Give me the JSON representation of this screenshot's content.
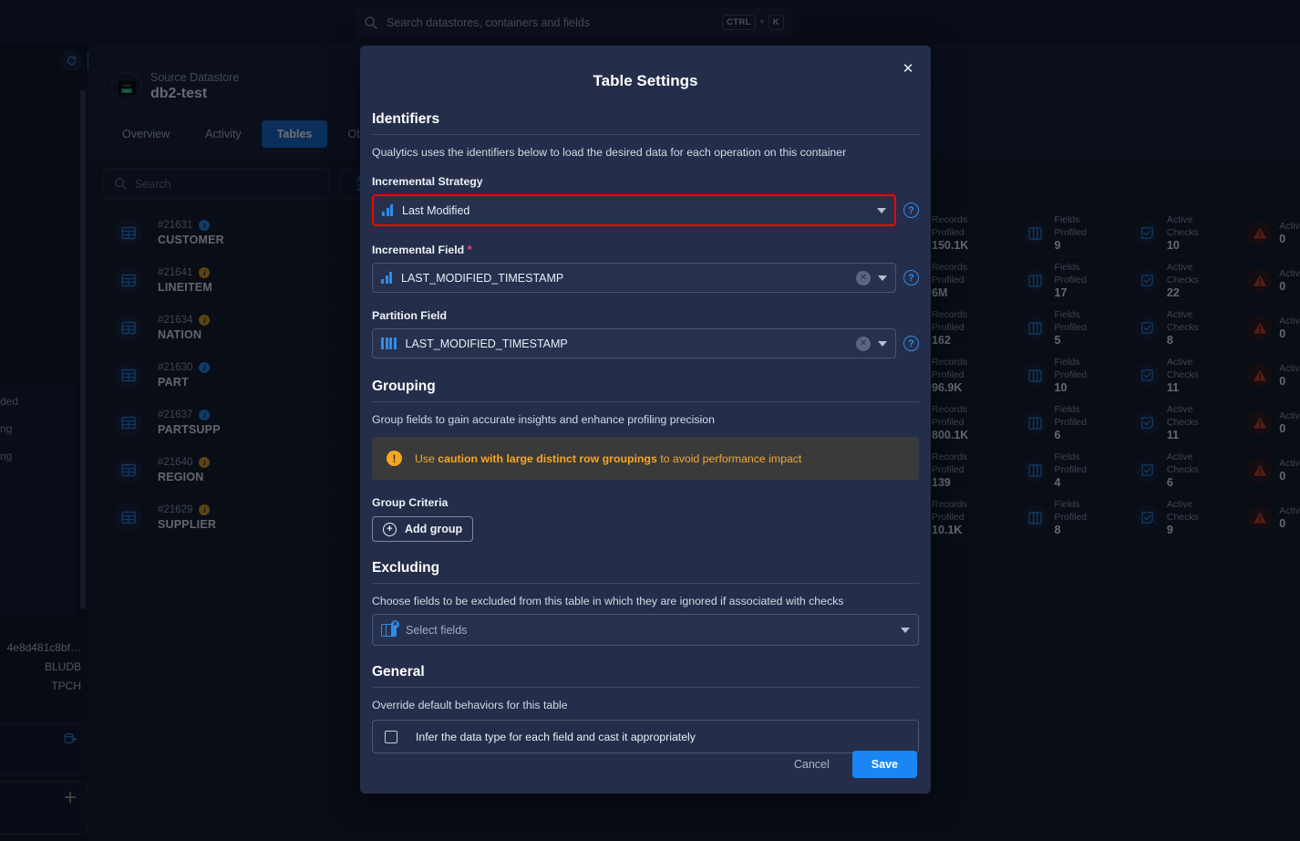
{
  "topbar": {
    "search_placeholder": "Search datastores, containers and fields",
    "shortcut_key1": "CTRL",
    "shortcut_plus": "+",
    "shortcut_key2": "K"
  },
  "datastore": {
    "kicker": "Source Datastore",
    "name": "db2-test",
    "logo_top": "IBM",
    "logo_bottom": "DB2",
    "tabs": [
      {
        "label": "Overview",
        "active": false
      },
      {
        "label": "Activity",
        "active": false
      },
      {
        "label": "Tables",
        "active": true
      },
      {
        "label": "Observ",
        "active": false
      }
    ],
    "toolbar": {
      "search_placeholder": "Search",
      "sort_a": "A",
      "sort_z": "Z"
    },
    "fragments": [
      "ded",
      "ng",
      "ng"
    ],
    "meta": [
      "4e8d481c8bf…",
      "BLUDB",
      "TPCH"
    ]
  },
  "tables": [
    {
      "id": "#21631",
      "name": "CUSTOMER",
      "badge": "blue",
      "stats": [
        {
          "label": "Records Profiled",
          "value": "150.1K",
          "icon": "none"
        },
        {
          "label": "Fields Profiled",
          "value": "9",
          "icon": "columns-icon"
        },
        {
          "label": "Active Checks",
          "value": "10",
          "icon": "check-square-icon"
        },
        {
          "label": "Activ",
          "value": "0",
          "icon": "alert-triangle-icon"
        }
      ]
    },
    {
      "id": "#21641",
      "name": "LINEITEM",
      "badge": "amber",
      "stats": [
        {
          "label": "Records Profiled",
          "value": "6M",
          "icon": "none"
        },
        {
          "label": "Fields Profiled",
          "value": "17",
          "icon": "columns-icon"
        },
        {
          "label": "Active Checks",
          "value": "22",
          "icon": "check-square-icon"
        },
        {
          "label": "Activ",
          "value": "0",
          "icon": "alert-triangle-icon"
        }
      ]
    },
    {
      "id": "#21634",
      "name": "NATION",
      "badge": "amber",
      "stats": [
        {
          "label": "Records Profiled",
          "value": "162",
          "icon": "none"
        },
        {
          "label": "Fields Profiled",
          "value": "5",
          "icon": "columns-icon"
        },
        {
          "label": "Active Checks",
          "value": "8",
          "icon": "check-square-icon"
        },
        {
          "label": "Activ",
          "value": "0",
          "icon": "alert-triangle-icon"
        }
      ]
    },
    {
      "id": "#21630",
      "name": "PART",
      "badge": "blue",
      "stats": [
        {
          "label": "Records Profiled",
          "value": "96.9K",
          "icon": "none"
        },
        {
          "label": "Fields Profiled",
          "value": "10",
          "icon": "columns-icon"
        },
        {
          "label": "Active Checks",
          "value": "11",
          "icon": "check-square-icon"
        },
        {
          "label": "Activ",
          "value": "0",
          "icon": "alert-triangle-icon"
        }
      ]
    },
    {
      "id": "#21637",
      "name": "PARTSUPP",
      "badge": "blue",
      "stats": [
        {
          "label": "Records Profiled",
          "value": "800.1K",
          "icon": "none"
        },
        {
          "label": "Fields Profiled",
          "value": "6",
          "icon": "columns-icon"
        },
        {
          "label": "Active Checks",
          "value": "11",
          "icon": "check-square-icon"
        },
        {
          "label": "Activ",
          "value": "0",
          "icon": "alert-triangle-icon"
        }
      ]
    },
    {
      "id": "#21640",
      "name": "REGION",
      "badge": "amber",
      "stats": [
        {
          "label": "Records Profiled",
          "value": "139",
          "icon": "none"
        },
        {
          "label": "Fields Profiled",
          "value": "4",
          "icon": "columns-icon"
        },
        {
          "label": "Active Checks",
          "value": "6",
          "icon": "check-square-icon"
        },
        {
          "label": "Activ",
          "value": "0",
          "icon": "alert-triangle-icon"
        }
      ]
    },
    {
      "id": "#21629",
      "name": "SUPPLIER",
      "badge": "amber",
      "stats": [
        {
          "label": "Records Profiled",
          "value": "10.1K",
          "icon": "none"
        },
        {
          "label": "Fields Profiled",
          "value": "8",
          "icon": "columns-icon"
        },
        {
          "label": "Active Checks",
          "value": "9",
          "icon": "check-square-icon"
        },
        {
          "label": "Activ",
          "value": "0",
          "icon": "alert-triangle-icon"
        }
      ]
    }
  ],
  "modal": {
    "title": "Table Settings",
    "close_label": "✕",
    "identifiers": {
      "heading": "Identifiers",
      "description": "Qualytics uses the identifiers below to load the desired data for each operation on this container",
      "incremental_strategy_label": "Incremental Strategy",
      "incremental_strategy_value": "Last Modified",
      "incremental_field_label": "Incremental Field",
      "incremental_field_required": "*",
      "incremental_field_value": "LAST_MODIFIED_TIMESTAMP",
      "partition_field_label": "Partition Field",
      "partition_field_value": "LAST_MODIFIED_TIMESTAMP",
      "help_label": "?"
    },
    "grouping": {
      "heading": "Grouping",
      "description": "Group fields to gain accurate insights and enhance profiling precision",
      "warning_prefix": "Use ",
      "warning_bold": "caution with large distinct row groupings",
      "warning_suffix": " to avoid performance impact",
      "criteria_label": "Group Criteria",
      "add_group_label": "Add group",
      "add_group_plus": "+"
    },
    "excluding": {
      "heading": "Excluding",
      "description": "Choose fields to be excluded from this table in which they are ignored if associated with checks",
      "select_placeholder": "Select fields"
    },
    "general": {
      "heading": "General",
      "description": "Override default behaviors for this table",
      "checkbox_label": "Infer the data type for each field and cast it appropriately",
      "checkbox_checked": false
    },
    "footer": {
      "cancel_label": "Cancel",
      "save_label": "Save"
    }
  },
  "colors": {
    "accent_blue": "#1b85f3",
    "modal_bg": "#242e4a",
    "highlight_red": "#ff0000",
    "warning_amber": "#f5a623",
    "required_pink": "#e8436f"
  }
}
